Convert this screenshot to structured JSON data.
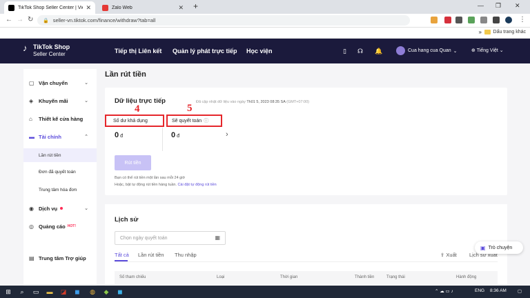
{
  "browser": {
    "tabs": [
      {
        "title": "TikTok Shop Seller Center | Vietn",
        "favicon_color": "#000000"
      },
      {
        "title": "Zalo Web",
        "favicon_color": "#e53935"
      }
    ],
    "url": "seller-vn.tiktok.com/finance/withdraw?tab=all",
    "bookmark": "Dấu trang khác"
  },
  "topnav": {
    "logo_line1": "TikTok Shop",
    "logo_line2": "Seller Center",
    "links": [
      "Tiếp thị Liên kết",
      "Quản lý phát trực tiếp",
      "Học viện"
    ],
    "shop_name": "Cua hang cua Quan",
    "language": "Tiếng Việt"
  },
  "sidebar": {
    "items": [
      {
        "label": "Vận chuyển",
        "icon": "box-icon"
      },
      {
        "label": "Khuyến mãi",
        "icon": "tag-icon"
      },
      {
        "label": "Thiết kế cửa hàng",
        "icon": "store-icon"
      },
      {
        "label": "Tài chính",
        "icon": "wallet-icon"
      },
      {
        "label": "Dịch vụ",
        "icon": "service-icon"
      },
      {
        "label": "Quảng cáo",
        "icon": "ads-icon",
        "badge": "HOT!"
      },
      {
        "label": "Trung tâm Trợ giúp",
        "icon": "help-icon"
      }
    ],
    "finance_sub": [
      "Lần rút tiền",
      "Đơn đã quyết toán",
      "Trung tâm hóa đơn"
    ]
  },
  "page": {
    "title": "Lần rút tiền",
    "live_title": "Dữ liệu trực tiếp",
    "updated_prefix": "Đã cập nhật dữ liệu vào ngày",
    "updated_time": "Th01 5, 2023 08:35 SA",
    "timezone": "(GMT+07:00)",
    "available_label": "Số dư khả dụng",
    "settled_label": "Sẽ quyết toán",
    "available_value": "0",
    "settled_value": "0",
    "currency": "đ",
    "annotation_4": "4",
    "annotation_5": "5",
    "withdraw_button": "Rút tiền",
    "note_line1": "Bạn có thể rút tiền một lần sau mỗi 24 giờ",
    "note_line2": "Hoặc, bật tự động rút tiền hàng tuần.",
    "note_link": "Cài đặt tự động rút tiền"
  },
  "history": {
    "title": "Lịch sử",
    "date_placeholder": "Chọn ngày quyết toán",
    "tabs": [
      "Tất cả",
      "Lần rút tiền",
      "Thu nhập"
    ],
    "export": "Xuất",
    "export_history": "Lịch sử xuất",
    "columns": [
      "Số tham chiếu",
      "Loại",
      "Thời gian",
      "Thành tiền",
      "Trạng thái",
      "Hành động"
    ]
  },
  "chat": {
    "label": "Trò chuyện"
  },
  "taskbar": {
    "lang": "ENG",
    "time": "8:36 AM"
  }
}
